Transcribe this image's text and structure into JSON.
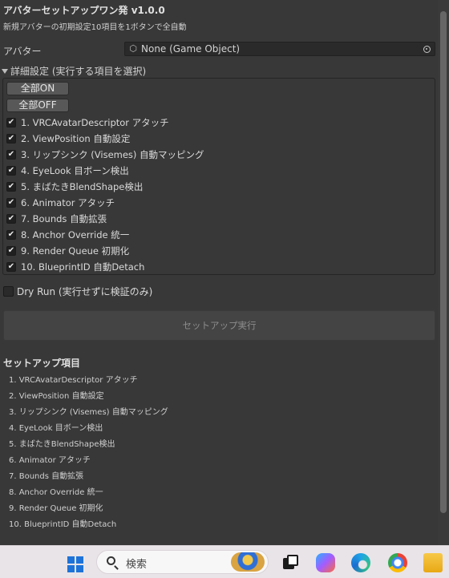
{
  "window": {
    "title": "アバターセットアップワン発 v1.0.0",
    "subtitle": "新規アバターの初期設定10項目を1ボタンで全自動"
  },
  "avatar_field": {
    "label": "アバター",
    "value": "None (Game Object)",
    "icon": "cube-icon",
    "picker_icon": "object-picker-icon"
  },
  "details": {
    "foldout_label": "詳細設定 (実行する項目を選択)",
    "expanded": true,
    "all_on_label": "全部ON",
    "all_off_label": "全部OFF",
    "items": [
      {
        "label": "1. VRCAvatarDescriptor アタッチ",
        "checked": true
      },
      {
        "label": "2. ViewPosition 自動設定",
        "checked": true
      },
      {
        "label": "3. リップシンク (Visemes) 自動マッピング",
        "checked": true
      },
      {
        "label": "4. EyeLook 目ボーン検出",
        "checked": true
      },
      {
        "label": "5. まばたきBlendShape検出",
        "checked": true
      },
      {
        "label": "6. Animator アタッチ",
        "checked": true
      },
      {
        "label": "7. Bounds 自動拡張",
        "checked": true
      },
      {
        "label": "8. Anchor Override 統一",
        "checked": true
      },
      {
        "label": "9. Render Queue 初期化",
        "checked": true
      },
      {
        "label": "10. BlueprintID 自動Detach",
        "checked": true
      }
    ]
  },
  "dry_run": {
    "label": "Dry Run (実行せずに検証のみ)",
    "checked": false
  },
  "run_button": {
    "label": "セットアップ実行",
    "enabled": false
  },
  "summary": {
    "title": "セットアップ項目",
    "items": [
      "1. VRCAvatarDescriptor アタッチ",
      "2. ViewPosition 自動設定",
      "3. リップシンク (Visemes) 自動マッピング",
      "4. EyeLook 目ボーン検出",
      "5. まばたきBlendShape検出",
      "6. Animator アタッチ",
      "7. Bounds 自動拡張",
      "8. Anchor Override 統一",
      "9. Render Queue 初期化",
      "10. BlueprintID 自動Detach"
    ]
  },
  "taskbar": {
    "search_placeholder": "検索",
    "icons": [
      "windows-start-icon",
      "search-icon",
      "task-view-icon",
      "copilot-icon",
      "edge-icon",
      "chrome-icon",
      "file-explorer-icon"
    ]
  },
  "colors": {
    "panel_bg": "#383838",
    "field_bg": "#2a2a2a",
    "button_bg": "#585858",
    "disabled_button_bg": "#444444",
    "taskbar_bg": "#e9e4e8",
    "windows_blue": "#1e73d8"
  }
}
